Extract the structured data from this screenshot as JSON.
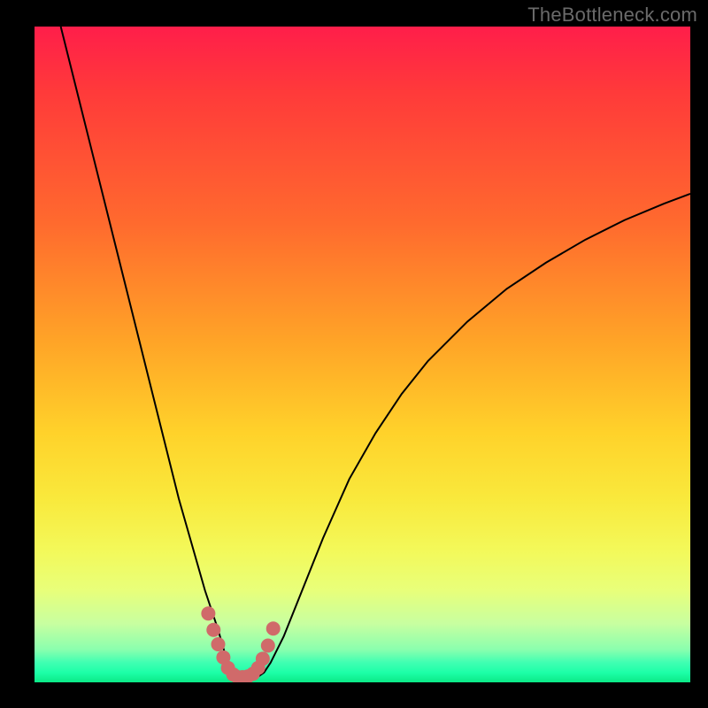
{
  "watermark": "TheBottleneck.com",
  "chart_data": {
    "type": "line",
    "title": "",
    "xlabel": "",
    "ylabel": "",
    "xlim": [
      0,
      100
    ],
    "ylim": [
      0,
      100
    ],
    "grid": false,
    "legend": false,
    "series": [
      {
        "name": "left-curve",
        "x": [
          4,
          6,
          8,
          10,
          12,
          14,
          16,
          18,
          20,
          22,
          24,
          26,
          28,
          29,
          30,
          31,
          32,
          33
        ],
        "y": [
          100,
          92,
          84,
          76,
          68,
          60,
          52,
          44,
          36,
          28,
          21,
          14,
          8,
          4.5,
          2,
          1,
          0.5,
          0.5
        ]
      },
      {
        "name": "right-curve",
        "x": [
          33,
          34,
          35,
          36,
          38,
          40,
          44,
          48,
          52,
          56,
          60,
          66,
          72,
          78,
          84,
          90,
          96,
          100
        ],
        "y": [
          0.5,
          0.8,
          1.5,
          3,
          7,
          12,
          22,
          31,
          38,
          44,
          49,
          55,
          60,
          64,
          67.5,
          70.5,
          73,
          74.5
        ]
      }
    ],
    "markers": {
      "name": "valley-markers",
      "color": "#d06a6a",
      "points_x": [
        26.5,
        27.3,
        28.0,
        28.8,
        29.5,
        30.3,
        31.0,
        31.7,
        32.5,
        33.3,
        34.1,
        34.8,
        35.6,
        36.4
      ],
      "points_y": [
        10.5,
        8.0,
        5.8,
        3.8,
        2.2,
        1.2,
        0.8,
        0.8,
        0.9,
        1.3,
        2.2,
        3.6,
        5.6,
        8.2
      ]
    },
    "background_gradient": {
      "top": "#ff1e4a",
      "mid_upper": "#ffa427",
      "mid": "#f9e93c",
      "mid_lower": "#c8ffa0",
      "bottom": "#0be986"
    }
  }
}
